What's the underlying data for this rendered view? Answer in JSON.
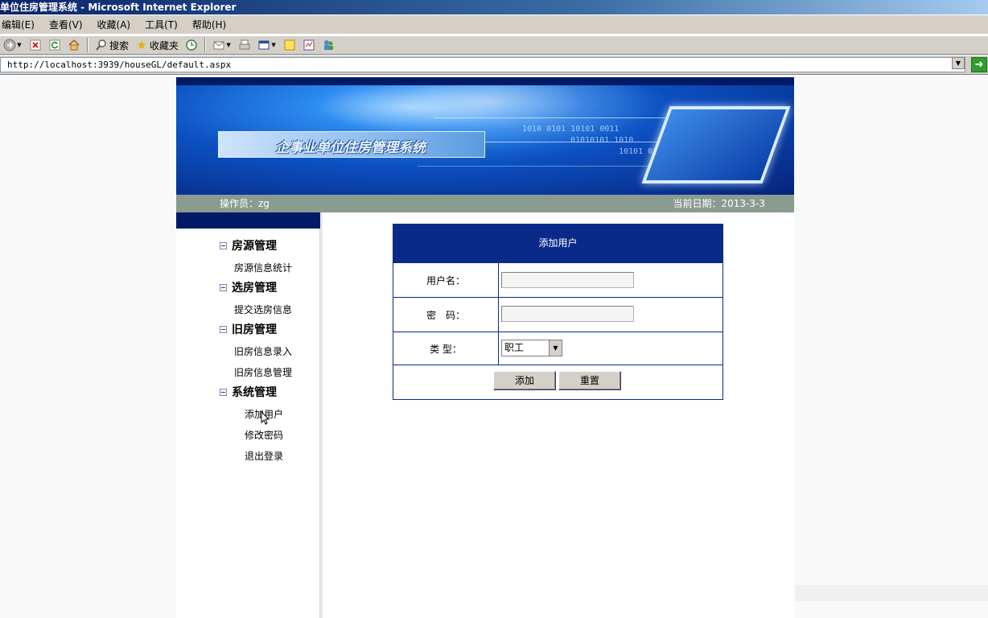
{
  "window": {
    "title": "单位住房管理系统 - Microsoft Internet Explorer"
  },
  "menu": {
    "items": [
      "编辑(E)",
      "查看(V)",
      "收藏(A)",
      "工具(T)",
      "帮助(H)"
    ]
  },
  "toolbar": {
    "search_label": "搜索",
    "favorites_label": "收藏夹"
  },
  "address": {
    "url": "http://localhost:3939/houseGL/default.aspx"
  },
  "banner": {
    "title": "企事业单位住房管理系统"
  },
  "info": {
    "operator": "操作员：zg",
    "date": "当前日期：2013-3-3"
  },
  "sidebar": {
    "sections": [
      {
        "title": "房源管理",
        "links": [
          "房源信息统计"
        ]
      },
      {
        "title": "选房管理",
        "links": [
          "提交选房信息"
        ]
      },
      {
        "title": "旧房管理",
        "links": [
          "旧房信息录入",
          "旧房信息管理"
        ]
      },
      {
        "title": "系统管理",
        "links": [
          "添加用户",
          "修改密码",
          "退出登录"
        ]
      }
    ]
  },
  "form": {
    "title": "添加用户",
    "username_label": "用户名：",
    "password_label": "密　码：",
    "type_label": "类  型：",
    "type_value": "职工",
    "add_button": "添加",
    "reset_button": "重置"
  },
  "colors": {
    "header_navy": "#0a2a8a",
    "info_bar": "#8a9c90"
  }
}
